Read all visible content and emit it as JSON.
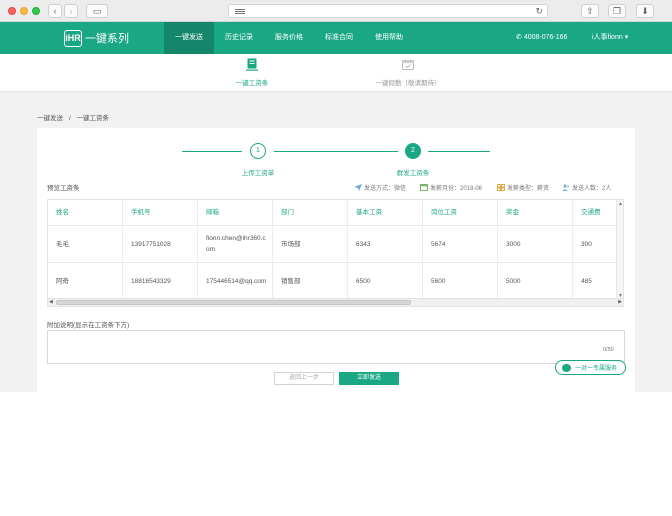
{
  "nav": {
    "logo_mark": "iHR",
    "logo_text": "一键系列",
    "items": [
      {
        "label": "一键发送"
      },
      {
        "label": "历史记录"
      },
      {
        "label": "服务价格"
      },
      {
        "label": "标准合同"
      },
      {
        "label": "使用帮助"
      }
    ],
    "phone": "4008-076-166",
    "user": "i人事fionn"
  },
  "subnav": {
    "tabs": [
      {
        "label": "一键工资条"
      },
      {
        "label": "一键假勤（敬请期待）"
      }
    ]
  },
  "breadcrumb": {
    "parent": "一键发送",
    "sep": "/",
    "current": "一键工资条"
  },
  "steps": [
    {
      "number": "1",
      "label": "上传工资单"
    },
    {
      "number": "2",
      "label": "群发工资条"
    }
  ],
  "preview": {
    "title": "预览工资条",
    "send_method": "发送方式：微信",
    "pay_month": "发薪月份：2018-06",
    "pay_type": "发薪类型：薪资",
    "recipients": "发送人数：2人"
  },
  "table": {
    "columns": [
      "姓名",
      "手机号",
      "邮箱",
      "部门",
      "基本工资",
      "岗位工资",
      "奖金",
      "交通费"
    ],
    "rows": [
      [
        "毛毛",
        "13917751028",
        "fionn.chen@ihr360.com",
        "市场部",
        "6343",
        "5674",
        "3000",
        "300"
      ],
      [
        "阿奇",
        "18816543329",
        "175446514@qq.com",
        "销售部",
        "6500",
        "5600",
        "5000",
        "485"
      ]
    ]
  },
  "note": {
    "label": "附加说明(显示在工资条下方)",
    "count": "0/50"
  },
  "buttons": {
    "back": "返回上一步",
    "send": "立即发送"
  },
  "service": {
    "label": "一对一专属服务"
  },
  "colors": {
    "brand": "#1aa784",
    "brand_dark": "#14866a"
  }
}
